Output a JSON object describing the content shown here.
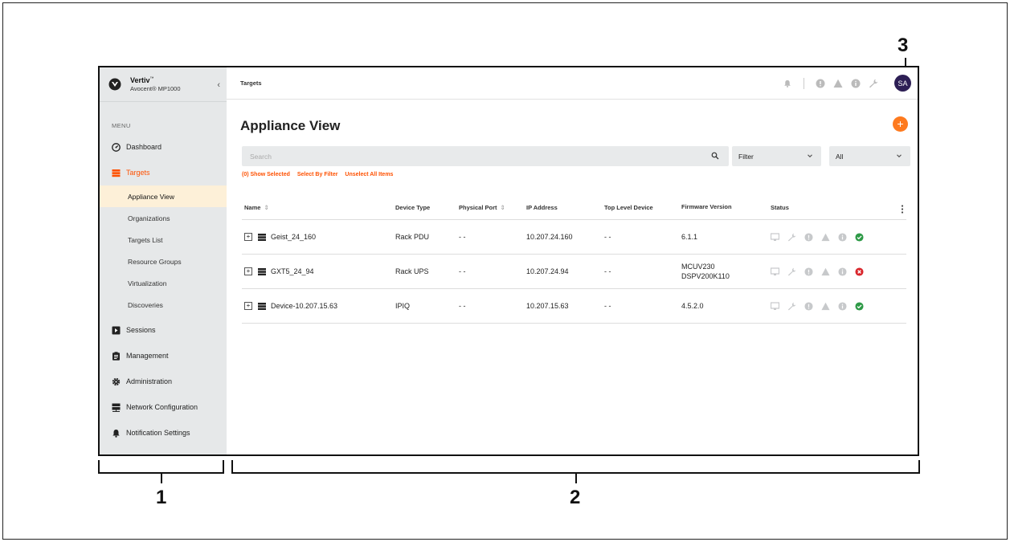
{
  "callouts": {
    "sidebar_num": "1",
    "main_num": "2",
    "user_num": "3"
  },
  "brand": {
    "name": "Vertiv",
    "tm": "™",
    "subtitle": "Avocent® MP1000"
  },
  "sidebar": {
    "menu_label": "MENU",
    "items": [
      {
        "label": "Dashboard",
        "icon": "dashboard-icon"
      },
      {
        "label": "Targets",
        "icon": "targets-icon"
      },
      {
        "label": "Sessions",
        "icon": "sessions-icon"
      },
      {
        "label": "Management",
        "icon": "management-icon"
      },
      {
        "label": "Administration",
        "icon": "gear-icon"
      },
      {
        "label": "Network Configuration",
        "icon": "network-icon"
      },
      {
        "label": "Notification Settings",
        "icon": "bell-icon"
      }
    ],
    "sub_items": [
      "Appliance View",
      "Organizations",
      "Targets List",
      "Resource Groups",
      "Virtualization",
      "Discoveries"
    ]
  },
  "topbar": {
    "breadcrumb": "Targets",
    "avatar": "SA"
  },
  "page": {
    "title": "Appliance View",
    "add": "+"
  },
  "search": {
    "placeholder": "Search",
    "value": ""
  },
  "filters": {
    "filter_value": "Filter",
    "scope_value": "All"
  },
  "links": {
    "show_selected": "(0) Show Selected",
    "select_by_filter": "Select By Filter",
    "unselect_all": "Unselect All Items"
  },
  "table": {
    "headers": {
      "name": "Name",
      "device_type": "Device Type",
      "physical_port": "Physical Port",
      "ip": "IP Address",
      "top_level": "Top Level Device",
      "firmware": "Firmware Version",
      "status": "Status"
    },
    "rows": [
      {
        "name": "Geist_24_160",
        "device_type": "Rack PDU",
        "physical_port": "- -",
        "ip": "10.207.24.160",
        "top_level": "- -",
        "firmware": "6.1.1",
        "firmware2": "",
        "state": "ok"
      },
      {
        "name": "GXT5_24_94",
        "device_type": "Rack UPS",
        "physical_port": "- -",
        "ip": "10.207.24.94",
        "top_level": "- -",
        "firmware": "MCUV230",
        "firmware2": "DSPV200K110",
        "state": "error"
      },
      {
        "name": "Device-10.207.15.63",
        "device_type": "IPIQ",
        "physical_port": "- -",
        "ip": "10.207.15.63",
        "top_level": "- -",
        "firmware": "4.5.2.0",
        "firmware2": "",
        "state": "ok"
      }
    ]
  },
  "colors": {
    "accent": "#fe5000",
    "avatar": "#2d1f55",
    "ok": "#2e9a47",
    "error": "#d9262c",
    "sidebar_bg": "#e6e8e9",
    "active_sub_bg": "#fdf0d8"
  }
}
